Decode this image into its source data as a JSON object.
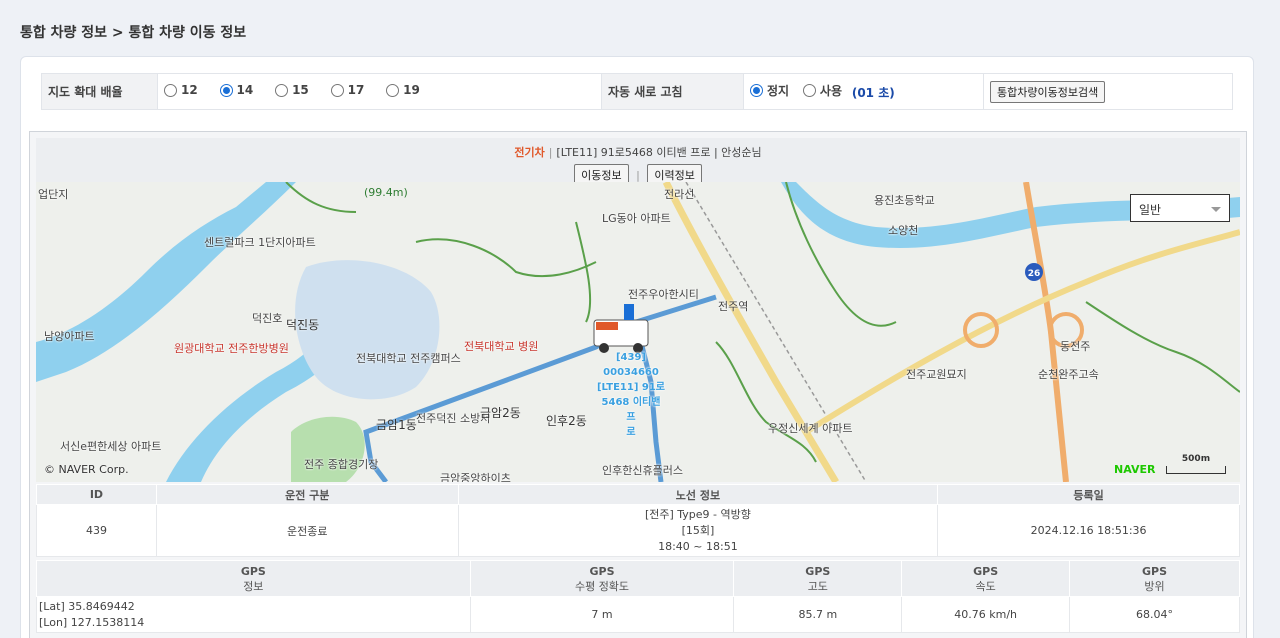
{
  "breadcrumb": "통합 차량 정보 > 통합 차량 이동 정보",
  "options": {
    "zoom_label": "지도 확대 배율",
    "zoom_levels": [
      {
        "label": "12",
        "checked": false
      },
      {
        "label": "14",
        "checked": true
      },
      {
        "label": "15",
        "checked": false
      },
      {
        "label": "17",
        "checked": false
      },
      {
        "label": "19",
        "checked": false
      }
    ],
    "refresh_label": "자동 새로 고침",
    "refresh_stop": "정지",
    "refresh_use": "사용",
    "refresh_interval": "(01 초)",
    "search_button": "통합차량이동정보검색"
  },
  "vehicle": {
    "type": "전기차",
    "detail": "[LTE11] 91로5468 이티밴 프로 | 안성순님",
    "move_button": "이동정보",
    "history_button": "이력정보"
  },
  "map": {
    "type_select": "일반",
    "copyright": "© NAVER Corp.",
    "brand": "NAVER",
    "scale": "500m",
    "vehicle_label": [
      "[439]",
      "00034660",
      "[LTE11] 91로",
      "5468 이티밴 프",
      "로"
    ],
    "labels_poi": [
      "업단지",
      "센트럴파크 1단지아파트",
      "덕진호",
      "남양아파트",
      "LG동아 아파트",
      "전주우아한시티",
      "전주역",
      "용진초등학교",
      "소양천",
      "동전주",
      "전주교원묘지",
      "우정신세계 아파트",
      "인후한신휴플러스",
      "금암중앙하이츠",
      "서신e편한세상 아파트",
      "전주 종합경기장",
      "전북대학교 전주캠퍼스",
      "전주덕진 소방서",
      "(99.4m)"
    ],
    "labels_area": [
      "덕진동",
      "금암2동",
      "인후2동",
      "금암1동"
    ],
    "labels_hospital": [
      "원광대학교 전주한방병원",
      "전북대학교 병원"
    ],
    "road_labels": [
      "전라선",
      "순천완주고속"
    ],
    "highway_number": "26"
  },
  "route_table": {
    "headers": [
      "ID",
      "운전 구분",
      "노선 정보",
      "등록일"
    ],
    "row": {
      "id": "439",
      "drive": "운전종료",
      "route1": "[전주] Type9 - 역방향",
      "route2": "[15회]",
      "route3": "18:40 ~ 18:51",
      "date": "2024.12.16 18:51:36"
    }
  },
  "gps_table": {
    "headers": [
      {
        "l1": "GPS",
        "l2": "정보"
      },
      {
        "l1": "GPS",
        "l2": "수평 정확도"
      },
      {
        "l1": "GPS",
        "l2": "고도"
      },
      {
        "l1": "GPS",
        "l2": "속도"
      },
      {
        "l1": "GPS",
        "l2": "방위"
      }
    ],
    "row": {
      "lat": "[Lat] 35.8469442",
      "lon": "[Lon] 127.1538114",
      "accuracy": "7 m",
      "altitude": "85.7 m",
      "speed": "40.76 km/h",
      "heading": "68.04°"
    }
  },
  "colors": {
    "accent": "#1a6fd6",
    "vehicle_type": "#e0582a",
    "route": "#5b9bd5",
    "water": "#8fd0ee",
    "naver": "#1ec800"
  }
}
